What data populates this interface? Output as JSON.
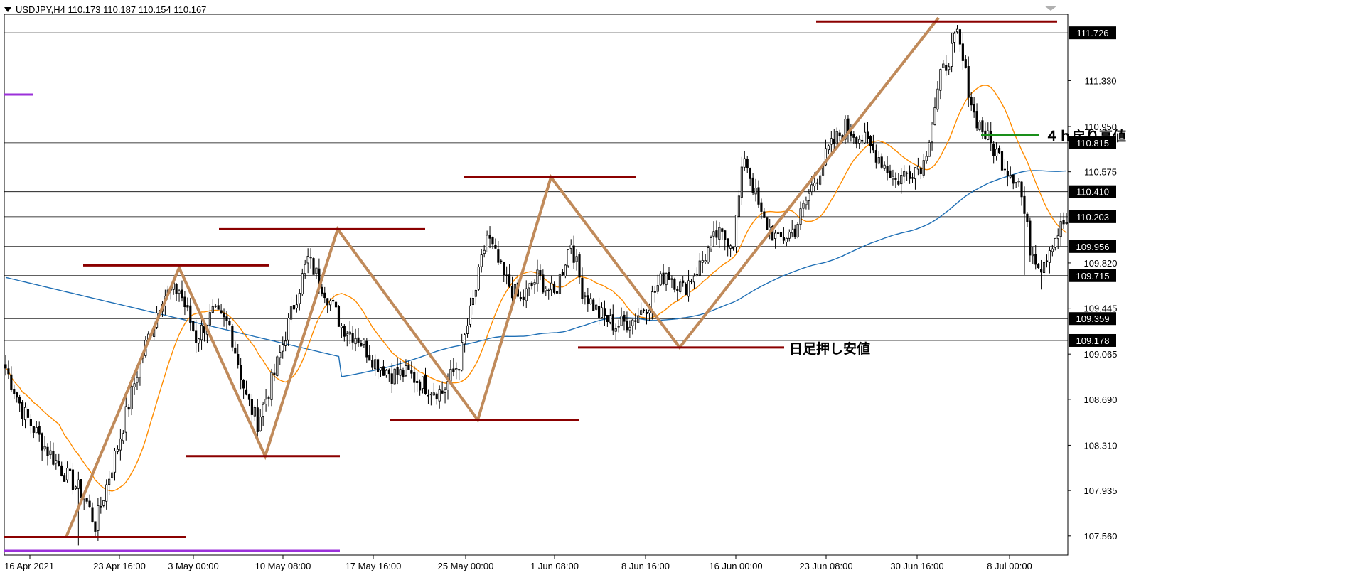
{
  "header": {
    "symbol_line": "USDJPY,H4  110.173 110.187 110.154 110.167"
  },
  "chart_data": {
    "type": "candlestick",
    "symbol": "USDJPY",
    "timeframe": "H4",
    "ohlc_header": {
      "open": 110.173,
      "high": 110.187,
      "low": 110.154,
      "close": 110.167
    },
    "ylim": [
      107.4,
      111.88
    ],
    "y_ticks": [
      "111.330",
      "110.950",
      "110.575",
      "109.820",
      "109.445",
      "109.065",
      "108.690",
      "108.310",
      "107.935",
      "107.560"
    ],
    "x_ticks": [
      "16 Apr 2021",
      "23 Apr 16:00",
      "3 May 00:00",
      "10 May 08:00",
      "17 May 16:00",
      "25 May 00:00",
      "1 Jun 08:00",
      "8 Jun 16:00",
      "16 Jun 00:00",
      "23 Jun 08:00",
      "30 Jun 16:00",
      "8 Jul 00:00"
    ],
    "horizontal_lines": [
      {
        "value": 111.726,
        "label": "111.726"
      },
      {
        "value": 110.815,
        "label": "110.815"
      },
      {
        "value": 110.41,
        "label": "110.410"
      },
      {
        "value": 110.203,
        "label": "110.203"
      },
      {
        "value": 109.956,
        "label": "109.956"
      },
      {
        "value": 109.715,
        "label": "109.715"
      },
      {
        "value": 109.359,
        "label": "109.359"
      },
      {
        "value": 109.178,
        "label": "109.178"
      }
    ],
    "zigzag": [
      107.55,
      109.78,
      108.22,
      110.1,
      108.52,
      110.53,
      109.12,
      111.85
    ],
    "resistance_levels": [
      109.8,
      110.1,
      110.53,
      111.82
    ],
    "support_levels": [
      107.55,
      108.22,
      108.52,
      109.12
    ],
    "annotations": [
      {
        "text": "４ｈ戻り高値",
        "value": 110.88,
        "color": "#008000"
      },
      {
        "text": "日足押し安値",
        "value": 109.12,
        "color": "#8b0000"
      }
    ],
    "colors": {
      "candle": "#000000",
      "ma_fast": "#ff8c00",
      "ma_slow": "#1f6fb5",
      "zigzag": "#c08a5a",
      "levels": "#8b0000",
      "purple": "#9b30d9",
      "green": "#1a8f1a"
    },
    "anchors": [
      [
        0,
        108.95
      ],
      [
        6,
        108.6
      ],
      [
        14,
        108.3
      ],
      [
        22,
        108.05
      ],
      [
        28,
        107.9
      ],
      [
        32,
        107.65
      ],
      [
        40,
        108.3
      ],
      [
        48,
        109.0
      ],
      [
        56,
        109.55
      ],
      [
        62,
        109.6
      ],
      [
        68,
        109.2
      ],
      [
        74,
        109.4
      ],
      [
        80,
        109.3
      ],
      [
        86,
        108.7
      ],
      [
        90,
        108.5
      ],
      [
        96,
        108.9
      ],
      [
        102,
        109.4
      ],
      [
        108,
        109.85
      ],
      [
        114,
        109.6
      ],
      [
        120,
        109.3
      ],
      [
        126,
        109.2
      ],
      [
        132,
        109.0
      ],
      [
        138,
        108.9
      ],
      [
        144,
        108.9
      ],
      [
        150,
        108.8
      ],
      [
        156,
        108.75
      ],
      [
        162,
        109.0
      ],
      [
        168,
        109.6
      ],
      [
        172,
        110.05
      ],
      [
        178,
        109.7
      ],
      [
        184,
        109.5
      ],
      [
        190,
        109.7
      ],
      [
        196,
        109.55
      ],
      [
        202,
        110.0
      ],
      [
        206,
        109.6
      ],
      [
        212,
        109.4
      ],
      [
        218,
        109.3
      ],
      [
        224,
        109.35
      ],
      [
        230,
        109.5
      ],
      [
        236,
        109.75
      ],
      [
        242,
        109.6
      ],
      [
        248,
        109.8
      ],
      [
        254,
        110.05
      ],
      [
        260,
        110.0
      ],
      [
        264,
        110.72
      ],
      [
        270,
        110.2
      ],
      [
        276,
        110.0
      ],
      [
        282,
        110.1
      ],
      [
        288,
        110.45
      ],
      [
        294,
        110.75
      ],
      [
        300,
        110.95
      ],
      [
        306,
        110.85
      ],
      [
        312,
        110.7
      ],
      [
        318,
        110.5
      ],
      [
        324,
        110.6
      ],
      [
        328,
        110.65
      ],
      [
        334,
        111.35
      ],
      [
        340,
        111.7
      ],
      [
        346,
        111.05
      ],
      [
        352,
        110.8
      ],
      [
        358,
        110.6
      ],
      [
        362,
        110.5
      ],
      [
        366,
        109.95
      ],
      [
        370,
        109.8
      ],
      [
        374,
        110.0
      ],
      [
        378,
        110.15
      ]
    ]
  }
}
